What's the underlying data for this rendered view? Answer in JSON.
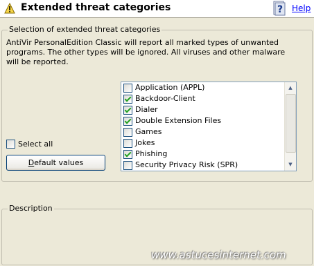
{
  "header": {
    "title": "Extended threat categories",
    "help_label": "Help",
    "icon": "warning-icon",
    "help_icon": "help-question-icon"
  },
  "selection": {
    "legend": "Selection of extended threat categories",
    "description": "AntiVir PersonalEdition Classic will report all marked types of unwanted programs. The other types will be ignored. All viruses and other malware will be reported.",
    "items": [
      {
        "label": "Application (APPL)",
        "checked": false
      },
      {
        "label": "Backdoor-Client",
        "checked": true
      },
      {
        "label": "Dialer",
        "checked": true
      },
      {
        "label": "Double Extension Files",
        "checked": true
      },
      {
        "label": "Games",
        "checked": false
      },
      {
        "label": "Jokes",
        "checked": false
      },
      {
        "label": "Phishing",
        "checked": true
      },
      {
        "label": "Security Privacy Risk (SPR)",
        "checked": false
      }
    ],
    "select_all_label": "Select all",
    "select_all_checked": false,
    "default_button_label": "Default values"
  },
  "description_group": {
    "legend": "Description"
  },
  "watermark": "www.astucesinternet.com",
  "colors": {
    "background": "#ece9d8",
    "link": "#0000ff",
    "check": "#21a121",
    "header_bg": "#ffffff"
  }
}
